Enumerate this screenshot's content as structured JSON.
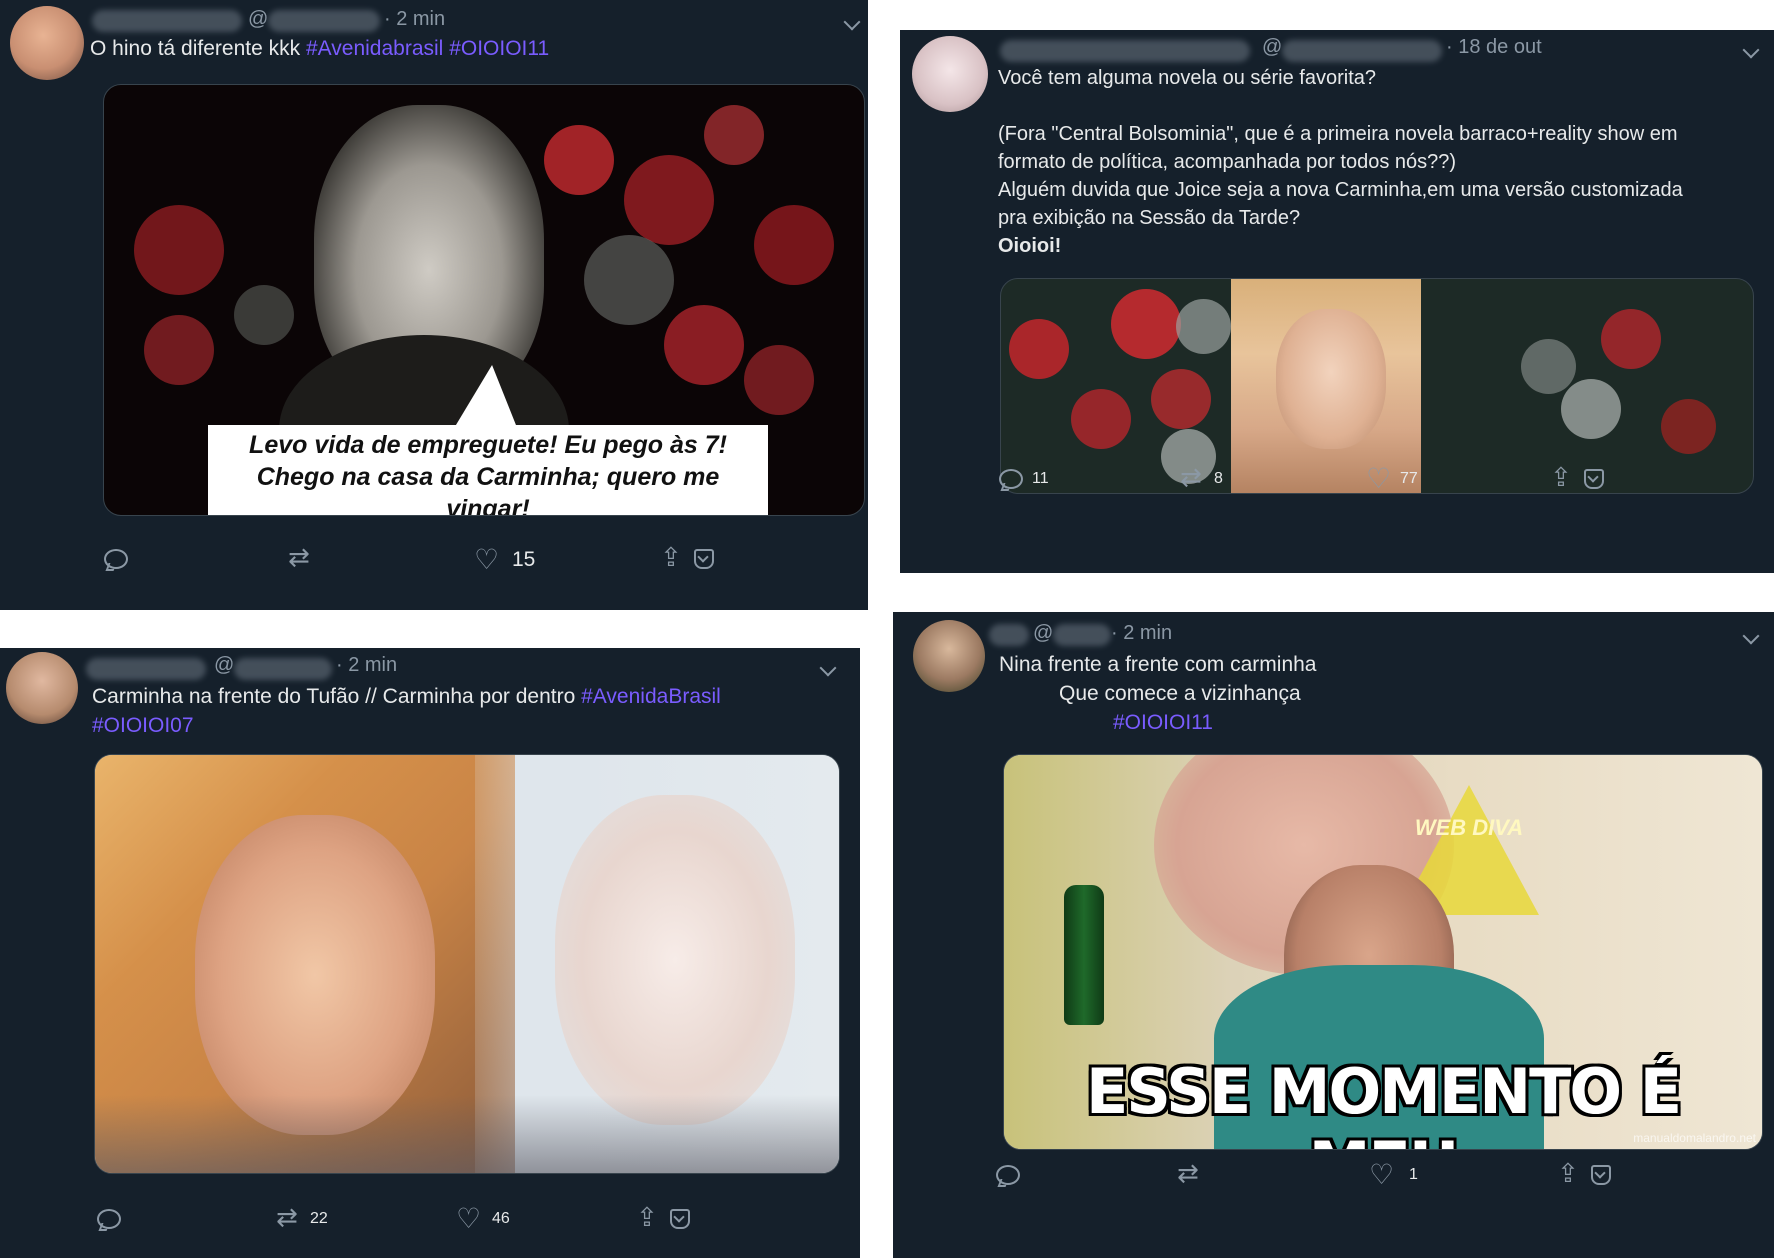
{
  "tweets": [
    {
      "time": "· 2 min",
      "at": "@",
      "text": "O hino tá diferente kkk",
      "hashtags": [
        "#Avenidabrasil",
        "#OIOIOI11"
      ],
      "media_caption": [
        "Levo vida de empreguete! Eu pego às 7!",
        "Chego na casa da Carminha; quero me vingar!"
      ],
      "counts": {
        "reply": "",
        "retweet": "",
        "like": "15"
      }
    },
    {
      "time": "· 18 de out",
      "at": "@",
      "lines": [
        "Você tem alguma novela ou série favorita?",
        "(Fora \"Central Bolsominia\", que é a primeira novela barraco+reality show em",
        "formato de política, acompanhada por todos nós??)",
        "Alguém duvida que Joice seja a nova Carminha,em uma versão customizada",
        "pra exibição na Sessão da Tarde?",
        "Oioioi!"
      ],
      "counts": {
        "reply": "11",
        "retweet": "8",
        "like": "77"
      }
    },
    {
      "time": "· 2 min",
      "at": "@",
      "text": "Carminha na frente do Tufão // Carminha por dentro",
      "hashtags": [
        "#AvenidaBrasil",
        "#OIOIOI07"
      ],
      "counts": {
        "reply": "",
        "retweet": "22",
        "like": "46"
      }
    },
    {
      "time": "· 2 min",
      "at": "@",
      "lines": [
        "Nina frente a frente com carminha",
        "Que comece a vizinhança"
      ],
      "hashtags": [
        "#OIOIOI11"
      ],
      "media_caption": "ESSE MOMENTO É MEU",
      "media_watermark_top": "WEB DIVA",
      "media_watermark_bottom": "manualdomalandro.net",
      "counts": {
        "reply": "",
        "retweet": "",
        "like": "1"
      }
    }
  ],
  "colors": {
    "background": "#15202b",
    "text": "#e7e9ea",
    "muted": "#8b98a5",
    "hashtag": "#7a5cff"
  }
}
